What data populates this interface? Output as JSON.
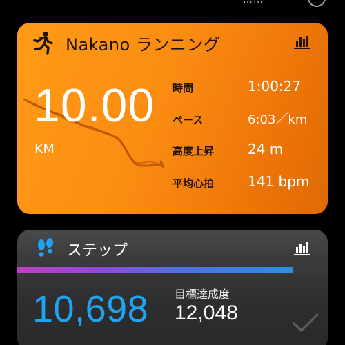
{
  "status_bar": {
    "clipped_text": "……"
  },
  "running_card": {
    "icon": "running-person-icon",
    "title": "Nakano ランニング",
    "stats_icon": "bar-chart-icon",
    "distance": "10.00",
    "distance_unit": "KM",
    "metrics": [
      {
        "label": "時間",
        "value": "1:00:27"
      },
      {
        "label": "ペース",
        "value": "6:03／km"
      },
      {
        "label": "高度上昇",
        "value": "24 m"
      },
      {
        "label": "平均心拍",
        "value": "141 bpm"
      }
    ],
    "colors": {
      "accent": "#fb8c12",
      "dark_text": "#1e1205",
      "route": "#b04d00"
    }
  },
  "steps_card": {
    "icon": "footprints-icon",
    "title": "ステップ",
    "stats_icon": "bar-chart-icon",
    "steps": "10,698",
    "goal_label": "目標達成度",
    "goal": "12,048",
    "progress_fraction": 0.888,
    "check_icon": "checkmark-icon",
    "colors": {
      "steps_value": "#1ea4f0",
      "card_bg": "#2e2e30"
    }
  }
}
